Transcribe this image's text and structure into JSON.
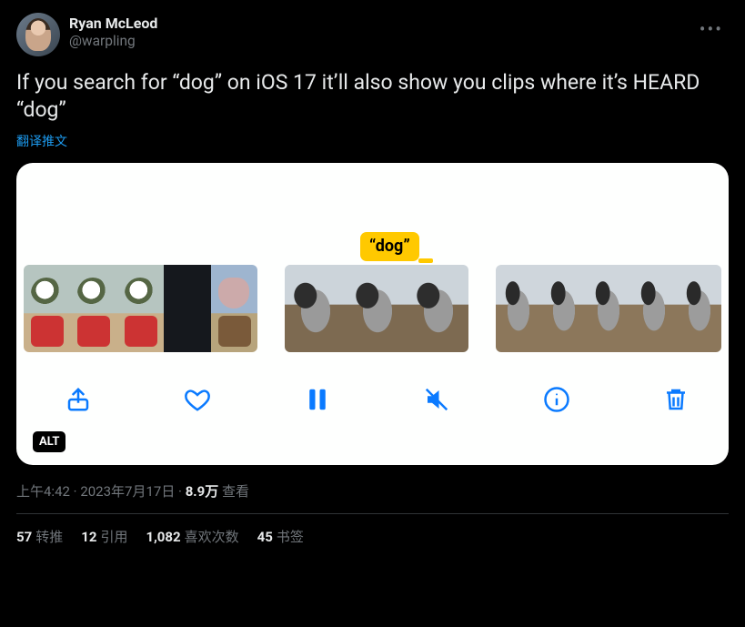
{
  "author": {
    "display_name": "Ryan McLeod",
    "handle": "@warpling"
  },
  "tweet_text": "If you search for “dog” on iOS 17 it’ll also show you clips where it’s HEARD “dog”",
  "translate_label": "翻译推文",
  "media": {
    "tooltip": "“dog”",
    "alt_badge": "ALT",
    "toolbar_icons": [
      "share-icon",
      "heart-icon",
      "pause-icon",
      "mute-icon",
      "info-icon",
      "trash-icon"
    ]
  },
  "meta": {
    "time": "上午4:42",
    "separator": " · ",
    "date": "2023年7月17日",
    "views_count": "8.9万",
    "views_label": " 查看"
  },
  "stats": {
    "retweets": {
      "count": "57",
      "label": "转推"
    },
    "quotes": {
      "count": "12",
      "label": "引用"
    },
    "likes": {
      "count": "1,082",
      "label": "喜欢次数"
    },
    "bookmarks": {
      "count": "45",
      "label": "书签"
    }
  }
}
